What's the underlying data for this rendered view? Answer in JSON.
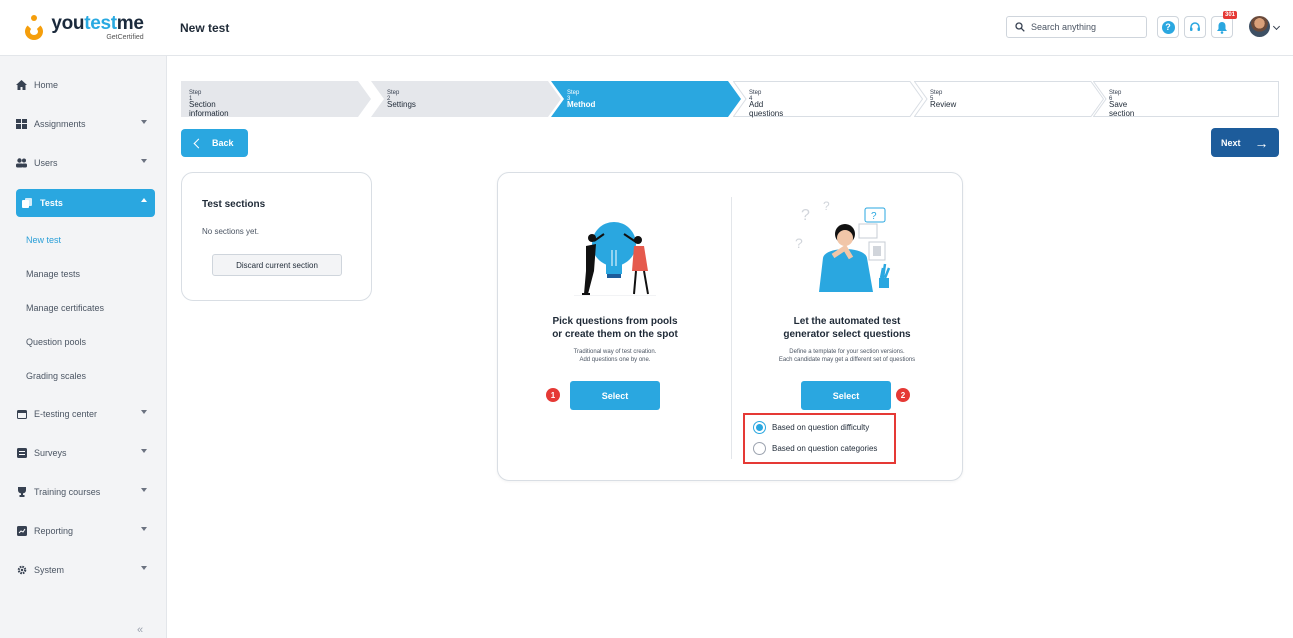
{
  "logo": {
    "brand_prefix": "you",
    "brand_accent": "test",
    "brand_suffix": "me",
    "tagline": "GetCertified"
  },
  "header": {
    "title": "New test",
    "search_placeholder": "Search anything",
    "notification_count": "301"
  },
  "sidebar": {
    "items": [
      {
        "label": "Home",
        "icon": "home-icon"
      },
      {
        "label": "Assignments",
        "icon": "assignments-icon"
      },
      {
        "label": "Users",
        "icon": "users-icon"
      },
      {
        "label": "Tests",
        "icon": "tests-icon"
      },
      {
        "label": "E-testing center",
        "icon": "calendar-icon"
      },
      {
        "label": "Surveys",
        "icon": "survey-icon"
      },
      {
        "label": "Training courses",
        "icon": "trophy-icon"
      },
      {
        "label": "Reporting",
        "icon": "chart-icon"
      },
      {
        "label": "System",
        "icon": "gear-icon"
      }
    ],
    "tests_sub": [
      "New test",
      "Manage tests",
      "Manage certificates",
      "Question pools",
      "Grading scales"
    ],
    "collapse": "«"
  },
  "steps": [
    {
      "num": "Step 1",
      "label": "Section information",
      "state": "done"
    },
    {
      "num": "Step 2",
      "label": "Settings",
      "state": "done"
    },
    {
      "num": "Step 3",
      "label": "Method",
      "state": "active"
    },
    {
      "num": "Step 4",
      "label": "Add questions",
      "state": "todo"
    },
    {
      "num": "Step 5",
      "label": "Review",
      "state": "todo"
    },
    {
      "num": "Step 6",
      "label": "Save section",
      "state": "todo"
    }
  ],
  "buttons": {
    "back": "Back",
    "next": "Next"
  },
  "sections_card": {
    "title": "Test sections",
    "empty": "No sections yet.",
    "discard": "Discard current section"
  },
  "method": {
    "manual": {
      "title_line1": "Pick questions from pools",
      "title_line2": "or create them on the spot",
      "desc_line1": "Traditional way of test creation.",
      "desc_line2": "Add questions one by one.",
      "select": "Select",
      "marker": "1"
    },
    "auto": {
      "title_line1": "Let the automated test",
      "title_line2": "generator select questions",
      "desc_line1": "Define a template for your section versions.",
      "desc_line2": "Each candidate may get a different set of questions",
      "select": "Select",
      "marker": "2",
      "options": [
        {
          "label": "Based on question difficulty",
          "checked": true
        },
        {
          "label": "Based on question categories",
          "checked": false
        }
      ]
    }
  },
  "colors": {
    "accent": "#2aa7e0",
    "next": "#1d5c9b",
    "marker": "#e53935",
    "logo_orange": "#f59e0b"
  }
}
